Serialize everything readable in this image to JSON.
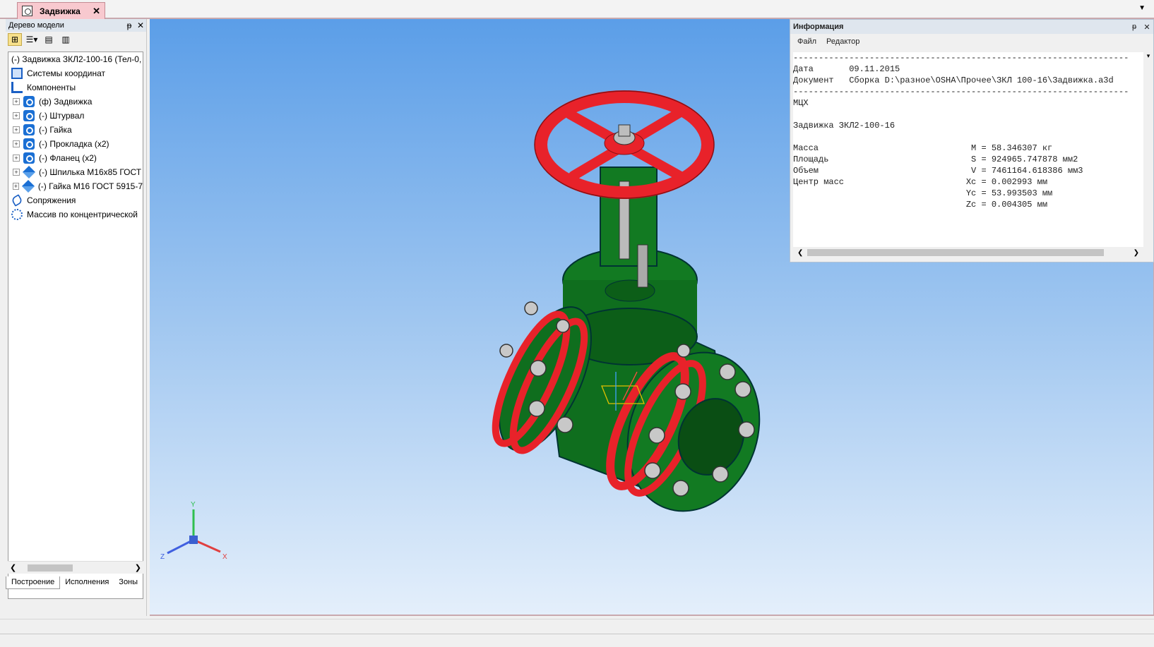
{
  "document_tab": {
    "label": "Задвижка",
    "close": "✕"
  },
  "tree_panel": {
    "title": "Дерево модели",
    "pin": "ᵽ",
    "close": "✕",
    "items": [
      {
        "label": "(-) Задвижка ЗКЛ2-100-16 (Тел-0, (",
        "icon": "assembly-icon",
        "level": 0
      },
      {
        "label": "Системы координат",
        "icon": "coordinate-system-icon",
        "level": 1
      },
      {
        "label": "Компоненты",
        "icon": "components-icon",
        "level": 1
      },
      {
        "label": "(ф) Задвижка",
        "icon": "part-icon",
        "level": 2
      },
      {
        "label": "(-) Штурвал",
        "icon": "part-icon",
        "level": 2
      },
      {
        "label": "(-) Гайка",
        "icon": "part-icon",
        "level": 2
      },
      {
        "label": "(-) Прокладка (x2)",
        "icon": "part-icon",
        "level": 2
      },
      {
        "label": "(-) Фланец (x2)",
        "icon": "part-icon",
        "level": 2
      },
      {
        "label": "(-) Шпилька М16х85 ГОСТ",
        "icon": "standard-part-icon",
        "level": 2
      },
      {
        "label": "(-) Гайка М16 ГОСТ 5915-7",
        "icon": "standard-part-icon",
        "level": 2
      },
      {
        "label": "Сопряжения",
        "icon": "mates-icon",
        "level": 1
      },
      {
        "label": "Массив по концентрической",
        "icon": "array-icon",
        "level": 1
      }
    ],
    "bottom_tabs": [
      "Построение",
      "Исполнения",
      "Зоны"
    ]
  },
  "axis_labels": {
    "x": "X",
    "y": "Y",
    "z": "Z"
  },
  "info_panel": {
    "title": "Информация",
    "pin": "ᵽ",
    "close": "✕",
    "menu": [
      "Файл",
      "Редактор"
    ],
    "lines": [
      "------------------------------------------------------------------",
      "Дата       09.11.2015",
      "Документ   Сборка D:\\разное\\OSHA\\Прочее\\ЗКЛ 100-16\\Задвижка.a3d",
      "------------------------------------------------------------------",
      "МЦХ",
      "",
      "Задвижка ЗКЛ2-100-16",
      "",
      "Масса                              M = 58.346307 кг",
      "Площадь                            S = 924965.747878 мм2",
      "Объем                              V = 7461164.618386 мм3",
      "Центр масс                        Xc = 0.002993 мм",
      "                                  Yc = 53.993503 мм",
      "                                  Zc = 0.004305 мм"
    ]
  },
  "colors": {
    "wheel": "#e8222a",
    "body": "#0f6e1e",
    "flange": "#e8222a",
    "bolt": "#c8c8c8"
  }
}
